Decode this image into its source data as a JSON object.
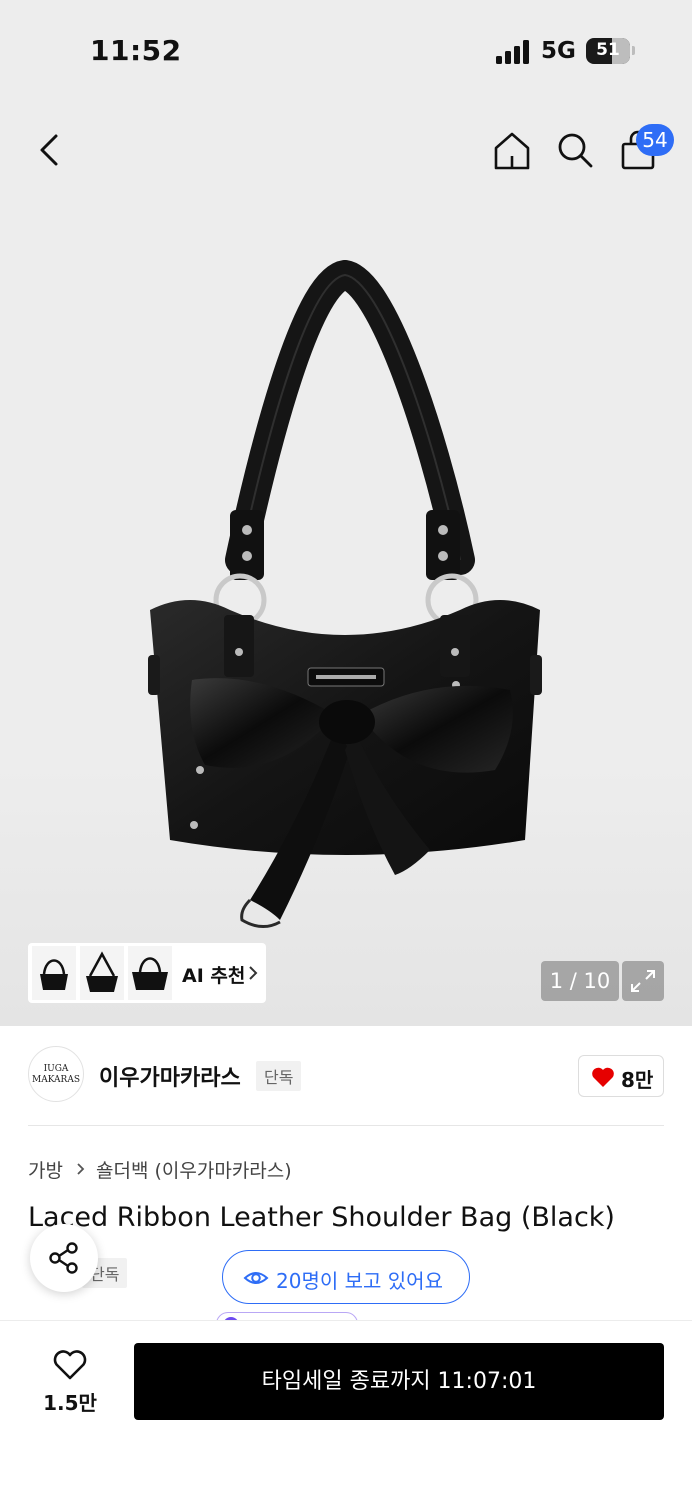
{
  "status_bar": {
    "time": "11:52",
    "network": "5G",
    "battery": "51"
  },
  "header": {
    "cart_count": "54"
  },
  "gallery": {
    "ai_recommend_label": "AI 추천",
    "pager": "1 / 10"
  },
  "brand": {
    "logo_text": "IUGA MAKARAS",
    "name": "이우가마카라스",
    "tag": "단독",
    "likes": "8만"
  },
  "product": {
    "breadcrumb": [
      "가방",
      "숄더백 (이우가마카라스)"
    ],
    "title": "Laced Ribbon Leather Shoulder Bag (Black)",
    "tag": "단독",
    "viewers_text": "20명이 보고 있어요"
  },
  "bottom_bar": {
    "wish_count": "1.5만",
    "cta_label": "타임세일 종료까지 11:07:01"
  },
  "colors": {
    "accent": "#2e6df6",
    "heart": "#e60000",
    "cta": "#000000"
  }
}
